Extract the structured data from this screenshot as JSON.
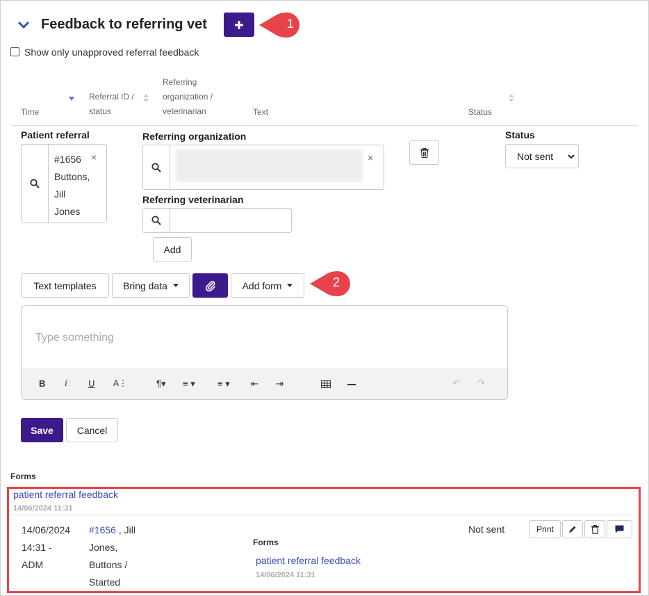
{
  "header": {
    "title": "Feedback to referring vet",
    "add_icon": "plus-icon",
    "callout_1": "1",
    "callout_2": "2"
  },
  "filter": {
    "show_unapproved_label": "Show only unapproved referral feedback"
  },
  "table_headers": {
    "time": "Time",
    "referral_id_l1": "Referral ID /",
    "referral_id_l2": "status",
    "ref_org_l1": "Referring",
    "ref_org_l2": "organization /",
    "ref_org_l3": "veterinarian",
    "text": "Text",
    "status": "Status"
  },
  "form": {
    "patient_referral_label": "Patient referral",
    "patient_tag_l1": "#1656",
    "patient_tag_l2": "Buttons,",
    "patient_tag_l3": "Jill",
    "patient_tag_l4": "Jones",
    "ref_org_label": "Referring organization",
    "ref_vet_label": "Referring veterinarian",
    "add_label": "Add",
    "status_label": "Status",
    "status_value": "Not sent",
    "clear_symbol": "×"
  },
  "editor_toolbar": {
    "text_templates": "Text templates",
    "bring_data": "Bring data",
    "add_form": "Add form",
    "placeholder": "Type something"
  },
  "actions": {
    "save": "Save",
    "cancel": "Cancel"
  },
  "forms_section": {
    "title": "Forms",
    "link": "patient referral feedback",
    "timestamp": "14/06/2024 11:31",
    "row": {
      "time_l1": "14/06/2024",
      "time_l2": "14:31 -",
      "time_l3": "ADM",
      "ref_id": "#1656",
      "ref_l1_rest": " , Jill",
      "ref_l2": "Jones,",
      "ref_l3": "Buttons /",
      "ref_l4": "Started",
      "forms_label": "Forms",
      "form_link": "patient referral feedback",
      "form_timestamp": "14/06/2024 11:31",
      "status": "Not sent",
      "print": "Print"
    }
  },
  "colors": {
    "accent": "#3d1a8c",
    "callout": "#e8434b",
    "link": "#3a4fb8",
    "highlight_border": "#e8434b"
  }
}
